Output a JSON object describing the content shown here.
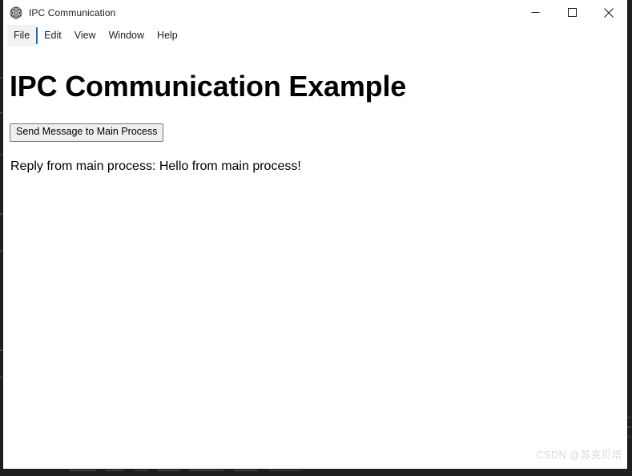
{
  "window": {
    "title": "IPC Communication",
    "icon": "electron-atom-icon",
    "controls": {
      "minimize": "minimize-icon",
      "maximize": "maximize-icon",
      "close": "close-icon"
    }
  },
  "menu": {
    "items": [
      {
        "label": "File",
        "active": true
      },
      {
        "label": "Edit",
        "active": false
      },
      {
        "label": "View",
        "active": false
      },
      {
        "label": "Window",
        "active": false
      },
      {
        "label": "Help",
        "active": false
      }
    ],
    "caret_color": "#1b6ec2"
  },
  "content": {
    "heading": "IPC Communication Example",
    "send_button_label": "Send Message to Main Process",
    "reply_text": "Reply from main process: Hello from main process!"
  },
  "watermark": {
    "text": "CSDN @苏克贝塔"
  },
  "colors": {
    "window_background": "#ffffff",
    "desktop_background": "#1e1e20",
    "menu_highlight": "#f2f2f2",
    "button_face": "#efefef",
    "button_border": "#767676",
    "text": "#000000",
    "watermark": "#d8d8d8"
  }
}
